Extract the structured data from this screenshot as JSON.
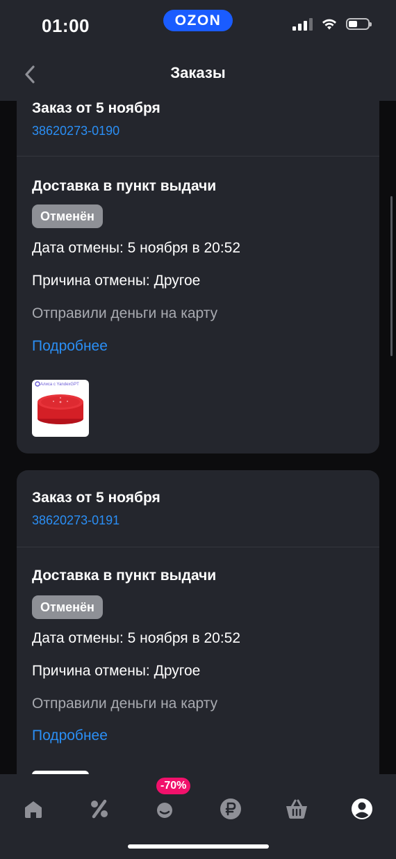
{
  "status_bar": {
    "time": "01:00",
    "brand_badge": "OZON"
  },
  "header": {
    "title": "Заказы"
  },
  "orders": [
    {
      "title": "Заказ от 5 ноября",
      "number": "38620273-0190",
      "delivery_type": "Доставка в пункт выдачи",
      "status": "Отменён",
      "cancel_date": "Дата отмены: 5 ноября в 20:52",
      "cancel_reason": "Причина отмены: Другое",
      "refund_note": "Отправили деньги на карту",
      "details_link": "Подробнее",
      "product_thumb_label": "Алиса с YandexGPT"
    },
    {
      "title": "Заказ от 5 ноября",
      "number": "38620273-0191",
      "delivery_type": "Доставка в пункт выдачи",
      "status": "Отменён",
      "cancel_date": "Дата отмены: 5 ноября в 20:52",
      "cancel_reason": "Причина отмены: Другое",
      "refund_note": "Отправили деньги на карту",
      "details_link": "Подробнее"
    }
  ],
  "bottom_nav": {
    "items": [
      {
        "icon": "home-icon"
      },
      {
        "icon": "percent-icon"
      },
      {
        "icon": "fresh-icon"
      },
      {
        "icon": "ruble-icon"
      },
      {
        "icon": "basket-icon"
      },
      {
        "icon": "profile-icon"
      }
    ],
    "promo_badge": "-70%"
  },
  "colors": {
    "background": "#0c0c0e",
    "card": "#24262d",
    "link": "#2b8ff5",
    "brand": "#1a5cff",
    "promo": "#f1116b",
    "status_pill": "#8e9096"
  }
}
